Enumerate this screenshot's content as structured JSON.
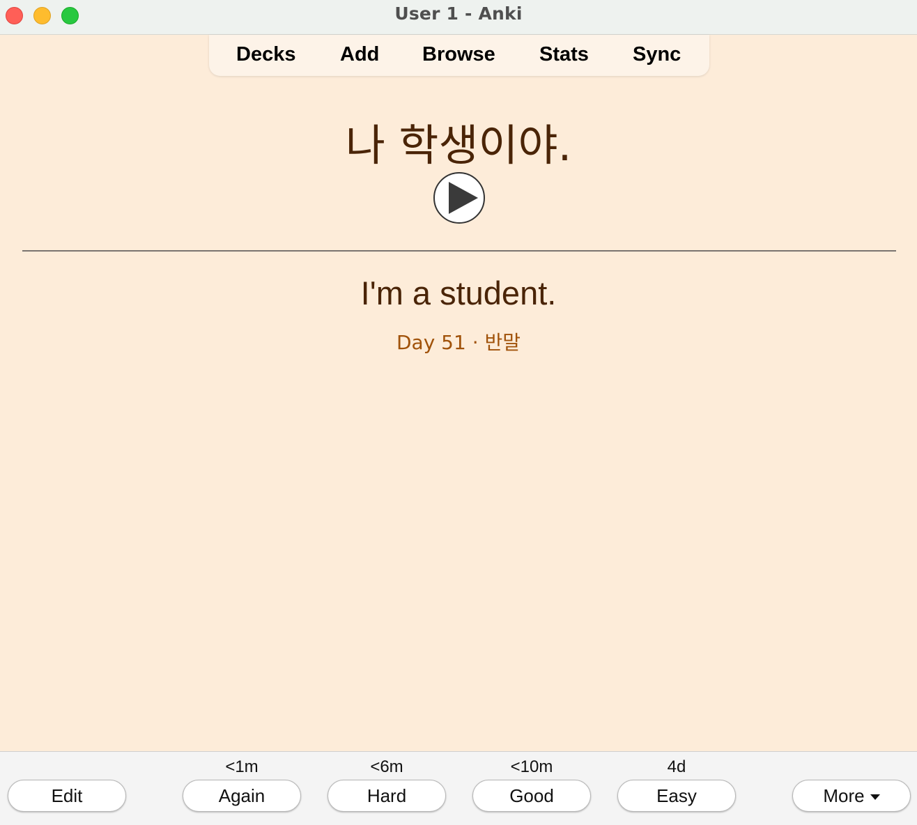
{
  "window": {
    "title": "User 1 - Anki"
  },
  "toolbar": {
    "items": [
      "Decks",
      "Add",
      "Browse",
      "Stats",
      "Sync"
    ]
  },
  "card": {
    "front": "나 학생이야.",
    "back": "I'm a student.",
    "meta": "Day 51 · 반말"
  },
  "bottom": {
    "edit_label": "Edit",
    "more_label": "More",
    "answers": [
      {
        "interval": "<1m",
        "label": "Again"
      },
      {
        "interval": "<6m",
        "label": "Hard"
      },
      {
        "interval": "<10m",
        "label": "Good"
      },
      {
        "interval": "4d",
        "label": "Easy"
      }
    ]
  },
  "colors": {
    "background": "#fdecd9",
    "card_text": "#4a2407",
    "meta_text": "#a0520a",
    "close": "#ff5f57",
    "minimize": "#febc2e",
    "maximize": "#28c840"
  },
  "icons": {
    "play": "play-icon",
    "more_caret": "caret-down-icon"
  }
}
